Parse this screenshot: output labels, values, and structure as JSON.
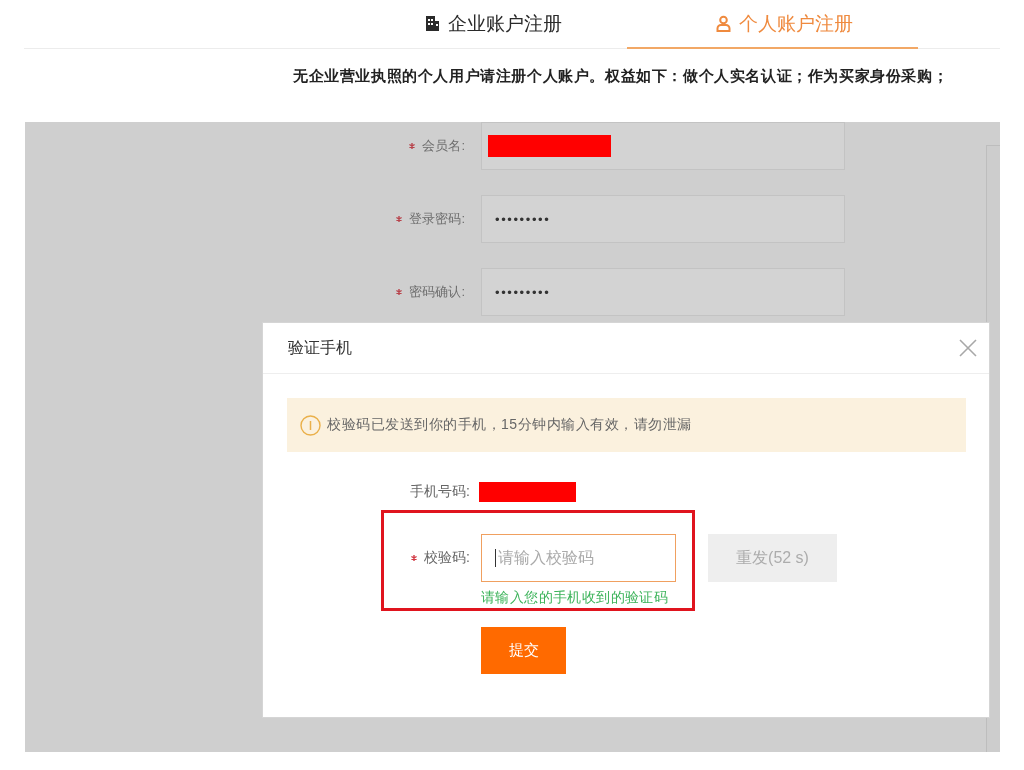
{
  "tabs": [
    {
      "label": "企业账户注册",
      "selected": false
    },
    {
      "label": "个人账户注册",
      "selected": true
    }
  ],
  "notice": "无企业营业执照的个人用户请注册个人账户。权益如下：做个人实名认证；作为买家身份采购；",
  "form": {
    "fields": [
      {
        "label": "会员名:",
        "required": true,
        "kind": "redacted"
      },
      {
        "label": "登录密码:",
        "required": true,
        "kind": "password",
        "value": "•••••••••"
      },
      {
        "label": "密码确认:",
        "required": true,
        "kind": "password",
        "value": "•••••••••"
      }
    ]
  },
  "dialog": {
    "title": "验证手机",
    "alert": "校验码已发送到你的手机，15分钟内输入有效，请勿泄漏",
    "phone": {
      "label": "手机号码:",
      "kind": "redacted"
    },
    "code": {
      "label": "校验码:",
      "required": true,
      "placeholder": "请输入校验码",
      "focused": true,
      "hint": "请输入您的手机收到的验证码"
    },
    "resend_button": {
      "label": "重发(52 s)",
      "disabled": true
    },
    "submit_button": "提交"
  }
}
